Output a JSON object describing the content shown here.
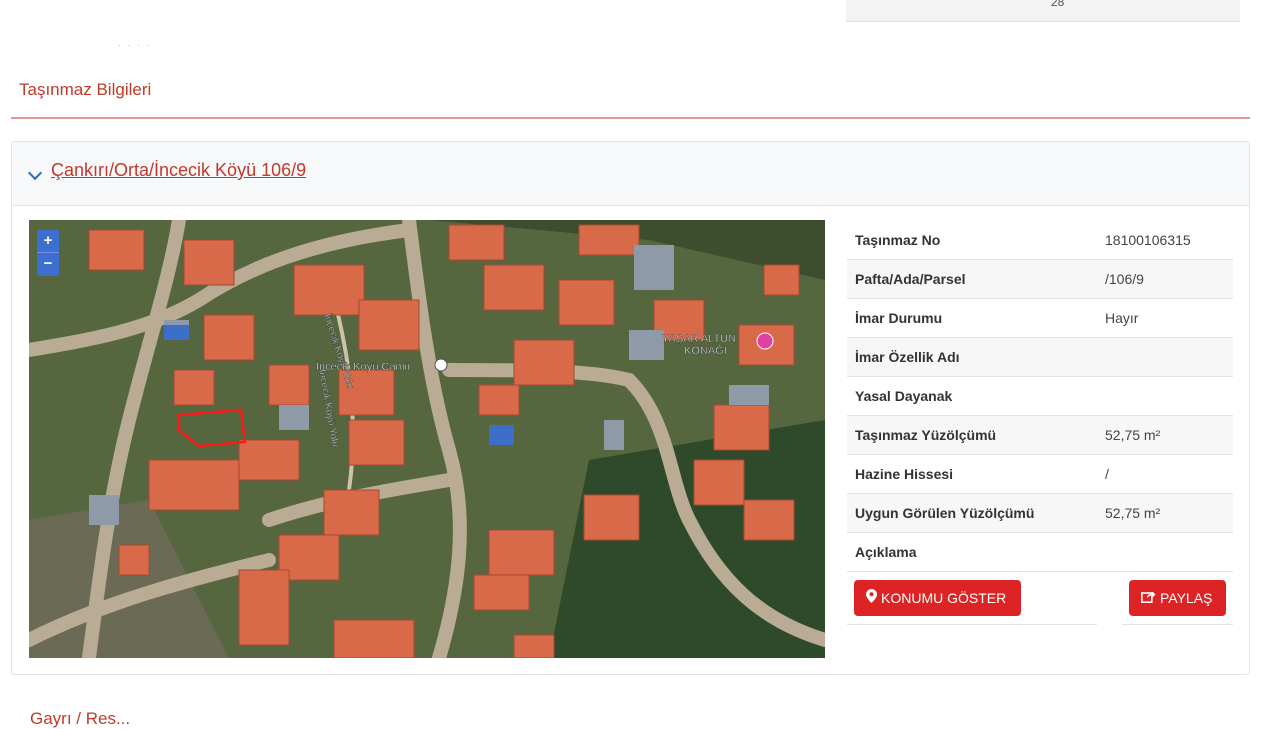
{
  "top_table": {
    "value": "28"
  },
  "section": {
    "title": "Taşınmaz Bilgileri"
  },
  "panel": {
    "title": "Çankırı/Orta/İncecik Köyü 106/9"
  },
  "map": {
    "zoom_in": "+",
    "zoom_out": "−",
    "labels": {
      "road": "İncecik Köyü Yolu",
      "mosque": "İncecik Köyü Camii",
      "konak_line1": "YAŞAR ALTUN",
      "konak_line2": "KONAĞI"
    }
  },
  "info": {
    "rows": [
      {
        "label": "Taşınmaz No",
        "value": "18100106315"
      },
      {
        "label": "Pafta/Ada/Parsel",
        "value": "/106/9"
      },
      {
        "label": "İmar Durumu",
        "value": "Hayır"
      },
      {
        "label": "İmar Özellik Adı",
        "value": ""
      },
      {
        "label": "Yasal Dayanak",
        "value": ""
      },
      {
        "label": "Taşınmaz Yüzölçümü",
        "value": "52,75 m²"
      },
      {
        "label": "Hazine Hissesi",
        "value": "/"
      },
      {
        "label": "Uygun Görülen Yüzölçümü",
        "value": "52,75 m²"
      },
      {
        "label": "Açıklama",
        "value": ""
      }
    ]
  },
  "buttons": {
    "show_location": "KONUMU GÖSTER",
    "share": "PAYLAŞ"
  },
  "next_section": {
    "title": "Gayrı / Res..."
  },
  "colors": {
    "accent": "#dd2424",
    "title_red": "#c0392b",
    "link_blue": "#2d6db3"
  }
}
